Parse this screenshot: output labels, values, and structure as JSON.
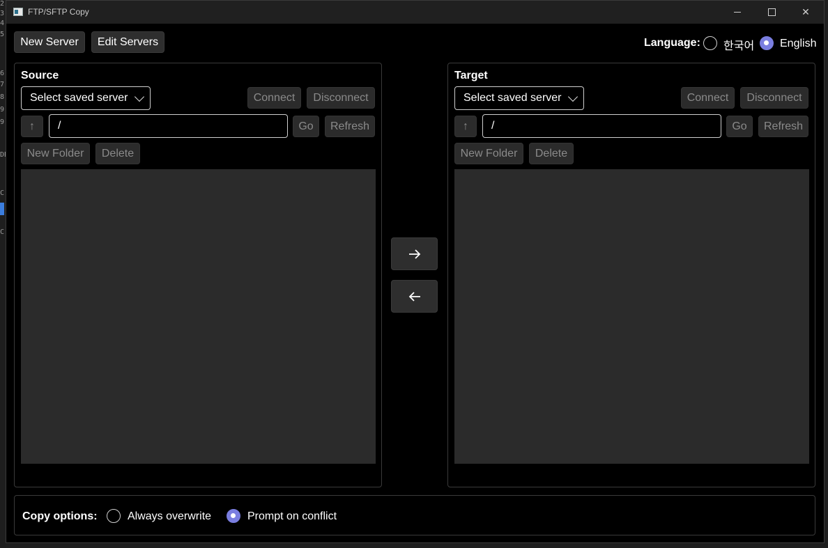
{
  "window": {
    "title": "FTP/SFTP Copy"
  },
  "toolbar": {
    "new_server": "New Server",
    "edit_servers": "Edit Servers"
  },
  "language": {
    "label": "Language:",
    "options": [
      "한국어",
      "English"
    ],
    "selected": "English"
  },
  "source": {
    "title": "Source",
    "server_select": "Select saved server",
    "connect": "Connect",
    "disconnect": "Disconnect",
    "up": "↑",
    "path": "/",
    "go": "Go",
    "refresh": "Refresh",
    "new_folder": "New Folder",
    "delete": "Delete"
  },
  "target": {
    "title": "Target",
    "server_select": "Select saved server",
    "connect": "Connect",
    "disconnect": "Disconnect",
    "up": "↑",
    "path": "/",
    "go": "Go",
    "refresh": "Refresh",
    "new_folder": "New Folder",
    "delete": "Delete"
  },
  "transfer": {
    "to_target": "→",
    "to_source": "←"
  },
  "copy_options": {
    "label": "Copy options:",
    "options": [
      "Always overwrite",
      "Prompt on conflict"
    ],
    "selected": "Prompt on conflict"
  },
  "colors": {
    "accent": "#7a7ee0",
    "window_bg": "#000000",
    "list_bg": "#2b2b2b",
    "button_bg": "#2e2e2e"
  }
}
